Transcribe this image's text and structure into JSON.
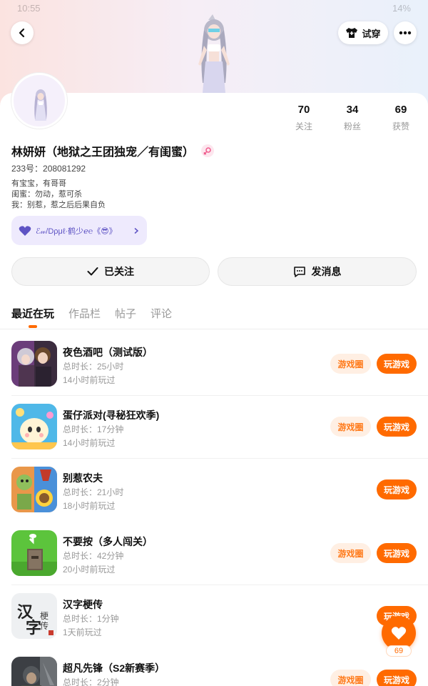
{
  "status_bar": {
    "time": "10:55",
    "right": "14%"
  },
  "header": {
    "try_on_label": "试穿"
  },
  "stats": [
    {
      "num": "70",
      "label": "关注"
    },
    {
      "num": "34",
      "label": "粉丝"
    },
    {
      "num": "69",
      "label": "获赞"
    }
  ],
  "profile": {
    "name": "林妍妍（地狱之王团独宠／有闺蜜）",
    "uid": "233号：208081292",
    "bio": [
      "有宝宝，有哥哥",
      "闺蜜：勿动，惹可杀",
      "我：别惹，惹之后后果自负"
    ],
    "tag": "ℰ𝓌/Dρμℓ·鹤少ℯ℮《😎》"
  },
  "actions": {
    "follow_label": "已关注",
    "message_label": "发消息"
  },
  "tabs": [
    "最近在玩",
    "作品栏",
    "帖子",
    "评论"
  ],
  "games": [
    {
      "title": "夜色酒吧（测试版）",
      "duration": "总时长：25小时",
      "ago": "14小时前玩过",
      "circle": "游戏圈",
      "play": "玩游戏"
    },
    {
      "title": "蛋仔派对(寻秘狂欢季)",
      "duration": "总时长：17分钟",
      "ago": "14小时前玩过",
      "circle": "游戏圈",
      "play": "玩游戏"
    },
    {
      "title": "别惹农夫",
      "duration": "总时长：21小时",
      "ago": "18小时前玩过",
      "circle": "",
      "play": "玩游戏"
    },
    {
      "title": "不要按（多人闯关）",
      "duration": "总时长：42分钟",
      "ago": "20小时前玩过",
      "circle": "游戏圈",
      "play": "玩游戏"
    },
    {
      "title": "汉字梗传",
      "duration": "总时长：1分钟",
      "ago": "1天前玩过",
      "circle": "",
      "play": "玩游戏"
    },
    {
      "title": "超凡先锋（S2新赛季）",
      "duration": "总时长：2分钟",
      "ago": "",
      "circle": "游戏圈",
      "play": "玩游戏"
    }
  ],
  "like": {
    "count": "69"
  },
  "colors": {
    "accent": "#ff6a00",
    "accent_light": "#ffefe3",
    "tag_bg": "#eeeafd"
  }
}
